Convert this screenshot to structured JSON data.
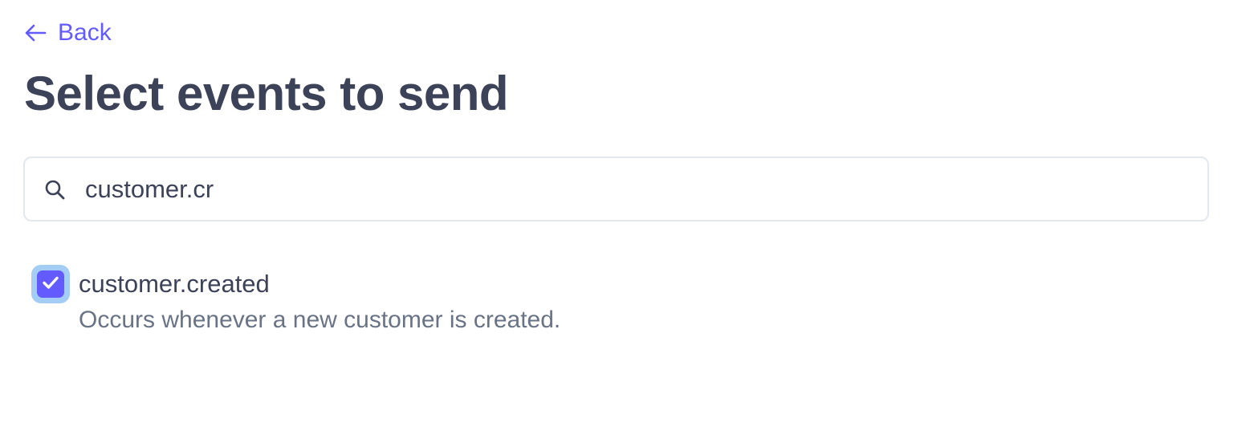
{
  "nav": {
    "back_label": "Back",
    "back_icon": "arrow-left-icon"
  },
  "page": {
    "title": "Select events to send"
  },
  "search": {
    "icon": "search-icon",
    "value": "customer.cr"
  },
  "events": [
    {
      "name": "customer.created",
      "description": "Occurs whenever a new customer is created.",
      "checked": true
    }
  ],
  "colors": {
    "accent": "#635bff",
    "title": "#3c4257",
    "muted": "#697386",
    "focus_ring": "#a3cdf5",
    "border": "#e3e8ee"
  }
}
